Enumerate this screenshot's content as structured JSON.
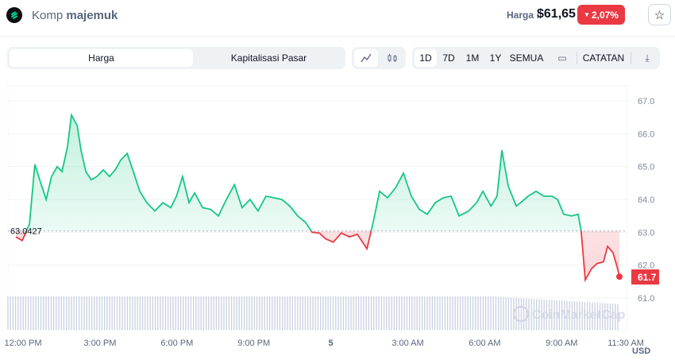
{
  "header": {
    "coin_prefix": "Komp",
    "coin_name": "majemuk",
    "price_label": "Harga :",
    "price": "$61,65",
    "change": "2,07%",
    "star_icon": "star-icon",
    "logo_icon": "compound-logo-icon"
  },
  "toolbar": {
    "tabs": [
      "Harga",
      "Kapitalisasi Pasar"
    ],
    "active_tab": "Harga",
    "chart_types": [
      "line-chart-icon",
      "candlestick-icon"
    ],
    "timeframes": [
      "1D",
      "7D",
      "1M",
      "1Y",
      "SEMUA"
    ],
    "active_timeframe": "1D",
    "calendar_icon": "calendar-icon",
    "notes_label": "CATATAN",
    "download_icon": "download-icon"
  },
  "chart_data": {
    "type": "line",
    "y_ticks": [
      "67.0",
      "66.0",
      "65.0",
      "64.0",
      "63.0",
      "62.0",
      "61.0"
    ],
    "ylim": [
      60.2,
      67.4
    ],
    "x_ticks": [
      "12:00 PM",
      "3:00 PM",
      "6:00 PM",
      "9:00 PM",
      "5",
      "3:00 AM",
      "6:00 AM",
      "9:00 AM",
      "11:30 AM"
    ],
    "x_tick_hours": [
      0,
      3,
      6,
      9,
      12,
      15,
      18,
      21,
      23.5
    ],
    "reference_value": 63.0427,
    "reference_label": "63.0427",
    "current_label": "61.7",
    "currency": "USD",
    "watermark": "CoinMarketCap",
    "colors": {
      "up": "#16c784",
      "down": "#ea3943"
    },
    "x_hours": [
      -0.28,
      -0.03,
      0.25,
      0.46,
      0.65,
      0.9,
      1.11,
      1.33,
      1.52,
      1.73,
      1.89,
      2.11,
      2.26,
      2.45,
      2.66,
      2.88,
      3.13,
      3.37,
      3.59,
      3.81,
      4.06,
      4.3,
      4.55,
      4.83,
      5.14,
      5.45,
      5.76,
      5.98,
      6.22,
      6.47,
      6.69,
      7.0,
      7.31,
      7.62,
      7.93,
      8.24,
      8.54,
      8.85,
      9.16,
      9.47,
      9.78,
      10.09,
      10.4,
      10.71,
      11.02,
      11.27,
      11.55,
      11.8,
      12.1,
      12.41,
      12.72,
      13.03,
      13.41,
      13.65,
      13.9,
      14.21,
      14.52,
      14.83,
      15.14,
      15.45,
      15.76,
      16.07,
      16.38,
      16.69,
      17.0,
      17.37,
      17.68,
      17.93,
      18.24,
      18.48,
      18.67,
      18.92,
      19.23,
      19.47,
      19.69,
      20.0,
      20.31,
      20.62,
      20.84,
      21.08,
      21.39,
      21.64,
      21.76,
      21.92,
      22.17,
      22.38,
      22.63,
      22.79,
      23.0,
      23.16,
      23.25
    ],
    "values": [
      62.86,
      62.75,
      63.25,
      65.07,
      64.6,
      64.0,
      64.7,
      65.0,
      64.85,
      65.6,
      66.57,
      66.25,
      65.5,
      64.85,
      64.6,
      64.7,
      64.9,
      64.7,
      64.9,
      65.2,
      65.4,
      64.85,
      64.25,
      63.9,
      63.65,
      63.9,
      63.75,
      64.1,
      64.7,
      63.9,
      64.2,
      63.75,
      63.7,
      63.5,
      64.0,
      64.45,
      63.75,
      64.0,
      63.65,
      64.1,
      64.05,
      64.0,
      63.8,
      63.5,
      63.3,
      63.0,
      62.98,
      62.8,
      62.7,
      62.98,
      62.86,
      62.94,
      62.5,
      63.3,
      64.25,
      64.05,
      64.35,
      64.8,
      64.1,
      63.7,
      63.55,
      63.9,
      64.05,
      64.1,
      63.5,
      63.65,
      63.9,
      64.25,
      63.8,
      64.1,
      65.5,
      64.4,
      63.8,
      63.95,
      64.1,
      64.25,
      64.1,
      64.1,
      64.0,
      63.55,
      63.5,
      63.55,
      63.05,
      61.55,
      61.9,
      62.05,
      62.1,
      62.57,
      62.38,
      61.95,
      61.65
    ]
  }
}
